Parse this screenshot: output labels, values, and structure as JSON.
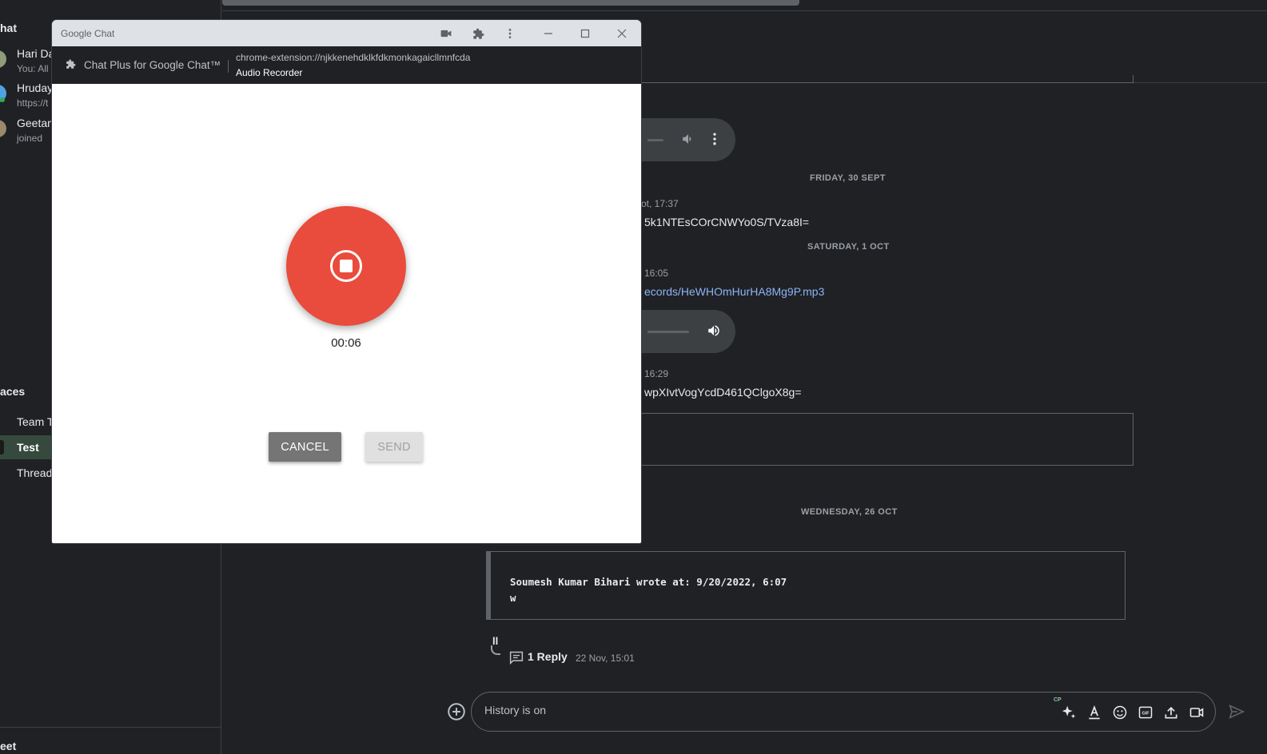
{
  "sidebar": {
    "chat_heading": "hat",
    "dms": [
      {
        "name": "Hari Da",
        "sub": "You: All"
      },
      {
        "name": "Hruday",
        "sub": "https://t"
      },
      {
        "name": "Geetan",
        "sub": "joined"
      }
    ],
    "spaces_heading": "aces",
    "spaces": [
      {
        "label": "Team T"
      },
      {
        "label": "Test"
      },
      {
        "label": "Thread"
      }
    ],
    "meet_heading": "eet"
  },
  "messages": {
    "date1": "FRIDAY, 30 SEPT",
    "time1": "ot, 17:37",
    "text1": "5k1NTEsCOrCNWYo0S/TVza8I=",
    "date2": "SATURDAY, 1 OCT",
    "time2": "16:05",
    "link2": "ecords/HeWHOmHurHA8Mg9P.mp3",
    "time3": "16:29",
    "text3": "wpXIvtVogYcdD461QClgoX8g=",
    "date3": "WEDNESDAY, 26 OCT",
    "quote_line1": "Soumesh Kumar Bihari wrote at: 9/20/2022, 6:07",
    "quote_line2": "w",
    "trailing_text": "ll",
    "reply_count": "1 Reply",
    "reply_time": "22 Nov, 15:01"
  },
  "composer": {
    "placeholder": "History is on",
    "badge": "CP"
  },
  "popup": {
    "window_title": "Google Chat",
    "extension_name": "Chat Plus for Google Chat™",
    "url": "chrome-extension://njkkenehdklkfdkmonkagaicllmnfcda",
    "page_title": "Audio Recorder",
    "timer": "00:06",
    "cancel_label": "CANCEL",
    "send_label": "SEND"
  },
  "colors": {
    "record": "#e94b3c",
    "background": "#202124",
    "link": "#8ab4f8"
  }
}
